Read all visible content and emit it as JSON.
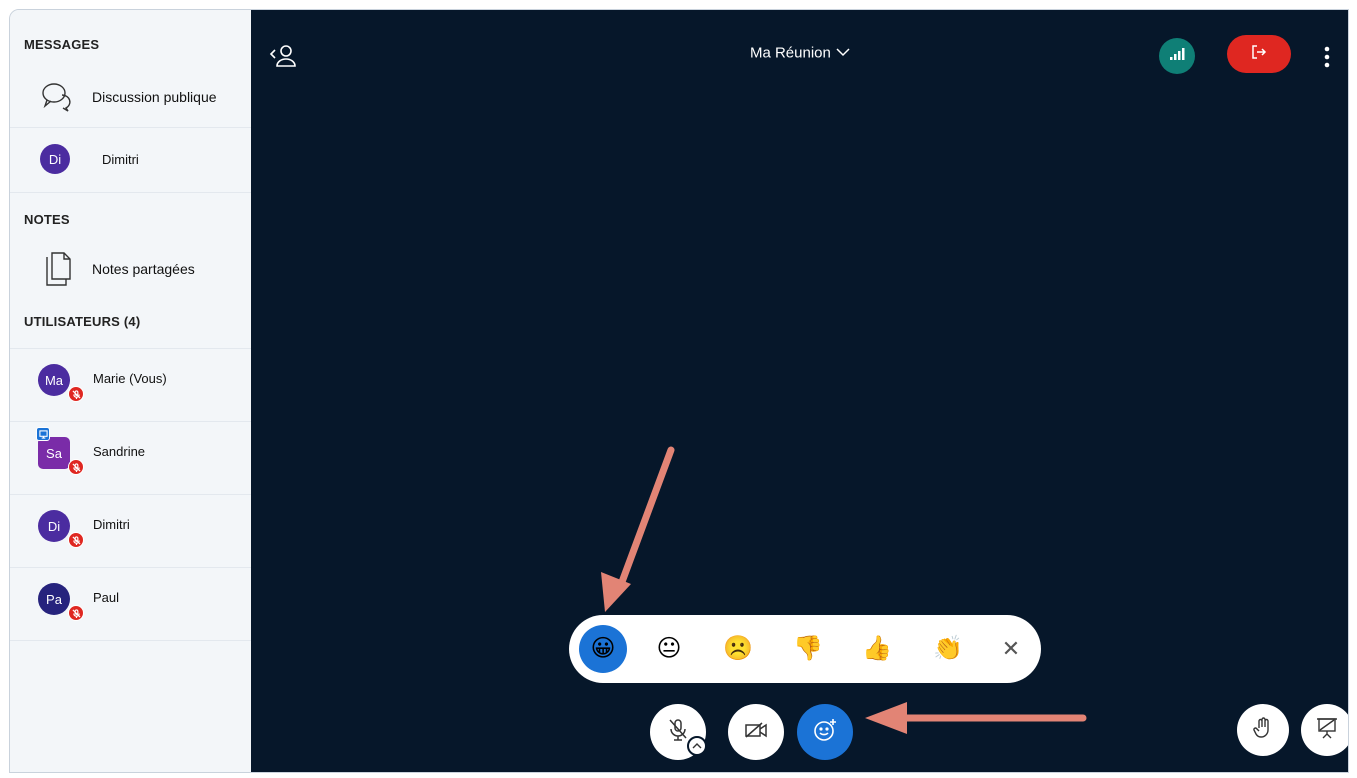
{
  "sidebar": {
    "messages_title": "MESSAGES",
    "public_chat_label": "Discussion publique",
    "private_chat": {
      "initials": "Di",
      "name": "Dimitri"
    },
    "notes_title": "NOTES",
    "shared_notes_label": "Notes partagées",
    "users_title": "UTILISATEURS (4)",
    "users": [
      {
        "initials": "Ma",
        "name": "Marie (Vous)"
      },
      {
        "initials": "Sa",
        "name": "Sandrine"
      },
      {
        "initials": "Di",
        "name": "Dimitri"
      },
      {
        "initials": "Pa",
        "name": "Paul"
      }
    ]
  },
  "header": {
    "meeting_title": "Ma Réunion"
  },
  "reactions": {
    "emojis": [
      "😀",
      "😐",
      "☹️",
      "👎",
      "👍",
      "👏"
    ],
    "close_symbol": "✕"
  },
  "colors": {
    "main_bg": "#06172a",
    "sidebar_bg": "#f3f6f9",
    "accent": "#1b73d6",
    "danger": "#df2721",
    "connection": "#0f7f76",
    "avatar_purple": "#4b2ca0",
    "avatar_violet": "#7a2ca8",
    "arrow": "#e28475"
  }
}
